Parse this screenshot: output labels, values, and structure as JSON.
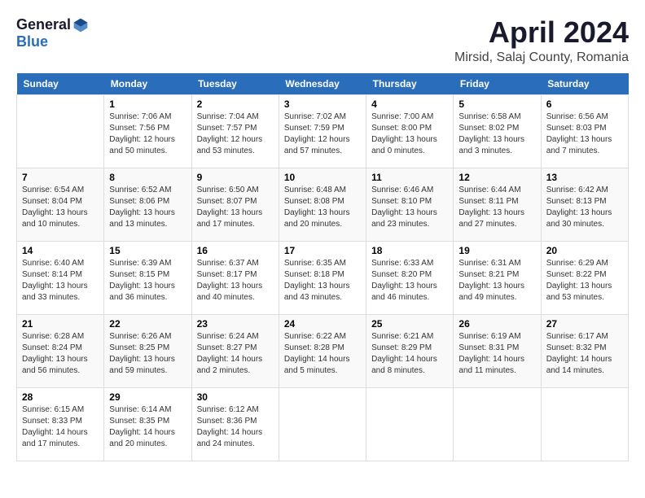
{
  "logo": {
    "general": "General",
    "blue": "Blue"
  },
  "title": {
    "month_year": "April 2024",
    "location": "Mirsid, Salaj County, Romania"
  },
  "weekdays": [
    "Sunday",
    "Monday",
    "Tuesday",
    "Wednesday",
    "Thursday",
    "Friday",
    "Saturday"
  ],
  "weeks": [
    [
      {
        "day": "",
        "sunrise": "",
        "sunset": "",
        "daylight": ""
      },
      {
        "day": "1",
        "sunrise": "Sunrise: 7:06 AM",
        "sunset": "Sunset: 7:56 PM",
        "daylight": "Daylight: 12 hours and 50 minutes."
      },
      {
        "day": "2",
        "sunrise": "Sunrise: 7:04 AM",
        "sunset": "Sunset: 7:57 PM",
        "daylight": "Daylight: 12 hours and 53 minutes."
      },
      {
        "day": "3",
        "sunrise": "Sunrise: 7:02 AM",
        "sunset": "Sunset: 7:59 PM",
        "daylight": "Daylight: 12 hours and 57 minutes."
      },
      {
        "day": "4",
        "sunrise": "Sunrise: 7:00 AM",
        "sunset": "Sunset: 8:00 PM",
        "daylight": "Daylight: 13 hours and 0 minutes."
      },
      {
        "day": "5",
        "sunrise": "Sunrise: 6:58 AM",
        "sunset": "Sunset: 8:02 PM",
        "daylight": "Daylight: 13 hours and 3 minutes."
      },
      {
        "day": "6",
        "sunrise": "Sunrise: 6:56 AM",
        "sunset": "Sunset: 8:03 PM",
        "daylight": "Daylight: 13 hours and 7 minutes."
      }
    ],
    [
      {
        "day": "7",
        "sunrise": "Sunrise: 6:54 AM",
        "sunset": "Sunset: 8:04 PM",
        "daylight": "Daylight: 13 hours and 10 minutes."
      },
      {
        "day": "8",
        "sunrise": "Sunrise: 6:52 AM",
        "sunset": "Sunset: 8:06 PM",
        "daylight": "Daylight: 13 hours and 13 minutes."
      },
      {
        "day": "9",
        "sunrise": "Sunrise: 6:50 AM",
        "sunset": "Sunset: 8:07 PM",
        "daylight": "Daylight: 13 hours and 17 minutes."
      },
      {
        "day": "10",
        "sunrise": "Sunrise: 6:48 AM",
        "sunset": "Sunset: 8:08 PM",
        "daylight": "Daylight: 13 hours and 20 minutes."
      },
      {
        "day": "11",
        "sunrise": "Sunrise: 6:46 AM",
        "sunset": "Sunset: 8:10 PM",
        "daylight": "Daylight: 13 hours and 23 minutes."
      },
      {
        "day": "12",
        "sunrise": "Sunrise: 6:44 AM",
        "sunset": "Sunset: 8:11 PM",
        "daylight": "Daylight: 13 hours and 27 minutes."
      },
      {
        "day": "13",
        "sunrise": "Sunrise: 6:42 AM",
        "sunset": "Sunset: 8:13 PM",
        "daylight": "Daylight: 13 hours and 30 minutes."
      }
    ],
    [
      {
        "day": "14",
        "sunrise": "Sunrise: 6:40 AM",
        "sunset": "Sunset: 8:14 PM",
        "daylight": "Daylight: 13 hours and 33 minutes."
      },
      {
        "day": "15",
        "sunrise": "Sunrise: 6:39 AM",
        "sunset": "Sunset: 8:15 PM",
        "daylight": "Daylight: 13 hours and 36 minutes."
      },
      {
        "day": "16",
        "sunrise": "Sunrise: 6:37 AM",
        "sunset": "Sunset: 8:17 PM",
        "daylight": "Daylight: 13 hours and 40 minutes."
      },
      {
        "day": "17",
        "sunrise": "Sunrise: 6:35 AM",
        "sunset": "Sunset: 8:18 PM",
        "daylight": "Daylight: 13 hours and 43 minutes."
      },
      {
        "day": "18",
        "sunrise": "Sunrise: 6:33 AM",
        "sunset": "Sunset: 8:20 PM",
        "daylight": "Daylight: 13 hours and 46 minutes."
      },
      {
        "day": "19",
        "sunrise": "Sunrise: 6:31 AM",
        "sunset": "Sunset: 8:21 PM",
        "daylight": "Daylight: 13 hours and 49 minutes."
      },
      {
        "day": "20",
        "sunrise": "Sunrise: 6:29 AM",
        "sunset": "Sunset: 8:22 PM",
        "daylight": "Daylight: 13 hours and 53 minutes."
      }
    ],
    [
      {
        "day": "21",
        "sunrise": "Sunrise: 6:28 AM",
        "sunset": "Sunset: 8:24 PM",
        "daylight": "Daylight: 13 hours and 56 minutes."
      },
      {
        "day": "22",
        "sunrise": "Sunrise: 6:26 AM",
        "sunset": "Sunset: 8:25 PM",
        "daylight": "Daylight: 13 hours and 59 minutes."
      },
      {
        "day": "23",
        "sunrise": "Sunrise: 6:24 AM",
        "sunset": "Sunset: 8:27 PM",
        "daylight": "Daylight: 14 hours and 2 minutes."
      },
      {
        "day": "24",
        "sunrise": "Sunrise: 6:22 AM",
        "sunset": "Sunset: 8:28 PM",
        "daylight": "Daylight: 14 hours and 5 minutes."
      },
      {
        "day": "25",
        "sunrise": "Sunrise: 6:21 AM",
        "sunset": "Sunset: 8:29 PM",
        "daylight": "Daylight: 14 hours and 8 minutes."
      },
      {
        "day": "26",
        "sunrise": "Sunrise: 6:19 AM",
        "sunset": "Sunset: 8:31 PM",
        "daylight": "Daylight: 14 hours and 11 minutes."
      },
      {
        "day": "27",
        "sunrise": "Sunrise: 6:17 AM",
        "sunset": "Sunset: 8:32 PM",
        "daylight": "Daylight: 14 hours and 14 minutes."
      }
    ],
    [
      {
        "day": "28",
        "sunrise": "Sunrise: 6:15 AM",
        "sunset": "Sunset: 8:33 PM",
        "daylight": "Daylight: 14 hours and 17 minutes."
      },
      {
        "day": "29",
        "sunrise": "Sunrise: 6:14 AM",
        "sunset": "Sunset: 8:35 PM",
        "daylight": "Daylight: 14 hours and 20 minutes."
      },
      {
        "day": "30",
        "sunrise": "Sunrise: 6:12 AM",
        "sunset": "Sunset: 8:36 PM",
        "daylight": "Daylight: 14 hours and 24 minutes."
      },
      {
        "day": "",
        "sunrise": "",
        "sunset": "",
        "daylight": ""
      },
      {
        "day": "",
        "sunrise": "",
        "sunset": "",
        "daylight": ""
      },
      {
        "day": "",
        "sunrise": "",
        "sunset": "",
        "daylight": ""
      },
      {
        "day": "",
        "sunrise": "",
        "sunset": "",
        "daylight": ""
      }
    ]
  ]
}
